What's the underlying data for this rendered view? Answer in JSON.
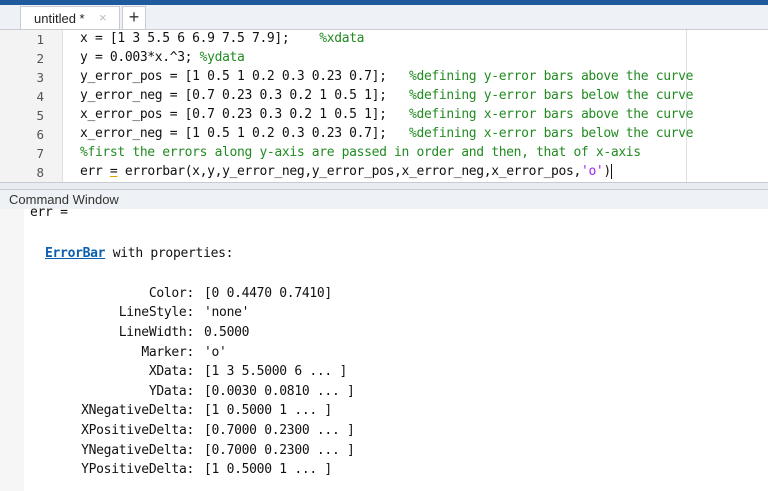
{
  "tab": {
    "label": "untitled *",
    "close": "×",
    "new": "+"
  },
  "editor": {
    "lines": [
      {
        "num": "1",
        "code": "x = [1 3 5.5 6 6.9 7.5 7.9];",
        "gap": "    ",
        "comment": "%xdata"
      },
      {
        "num": "2",
        "code": "y = 0.003*x.^3; ",
        "gap": "",
        "comment": "%ydata"
      },
      {
        "num": "3",
        "code": "y_error_pos = [1 0.5 1 0.2 0.3 0.23 0.7];",
        "gap": "   ",
        "comment": "%defining y-error bars above the curve"
      },
      {
        "num": "4",
        "code": "y_error_neg = [0.7 0.23 0.3 0.2 1 0.5 1];",
        "gap": "   ",
        "comment": "%defining y-error bars below the curve"
      },
      {
        "num": "5",
        "code": "x_error_pos = [0.7 0.23 0.3 0.2 1 0.5 1];",
        "gap": "   ",
        "comment": "%defining x-error bars above the curve"
      },
      {
        "num": "6",
        "code": "x_error_neg = [1 0.5 1 0.2 0.3 0.23 0.7];",
        "gap": "   ",
        "comment": "%defining x-error bars below the curve"
      },
      {
        "num": "7",
        "code": "",
        "gap": "",
        "comment": "%first the errors along y-axis are passed in order and then, that of x-axis"
      }
    ],
    "line8": {
      "num": "8",
      "pre": "err ",
      "eq": "=",
      "mid": " errorbar(x,y,y_error_neg,y_error_pos,x_error_neg,x_error_pos,",
      "str": "'o'",
      "end": ")"
    }
  },
  "command_window": {
    "title": "Command Window",
    "err_line": "err =",
    "object_link": "ErrorBar",
    "object_suffix": " with properties:",
    "properties": [
      {
        "name": "Color:",
        "value": "[0 0.4470 0.7410]"
      },
      {
        "name": "LineStyle:",
        "value": "'none'"
      },
      {
        "name": "LineWidth:",
        "value": "0.5000"
      },
      {
        "name": "Marker:",
        "value": "'o'"
      },
      {
        "name": "XData:",
        "value": "[1 3 5.5000 6 ... ]"
      },
      {
        "name": "YData:",
        "value": "[0.0030 0.0810 ... ]"
      },
      {
        "name": "XNegativeDelta:",
        "value": "[1 0.5000 1 ... ]"
      },
      {
        "name": "XPositiveDelta:",
        "value": "[0.7000 0.2300 ... ]"
      },
      {
        "name": "YNegativeDelta:",
        "value": "[0.7000 0.2300 ... ]"
      },
      {
        "name": "YPositiveDelta:",
        "value": "[1 0.5000 1 ... ]"
      }
    ]
  }
}
